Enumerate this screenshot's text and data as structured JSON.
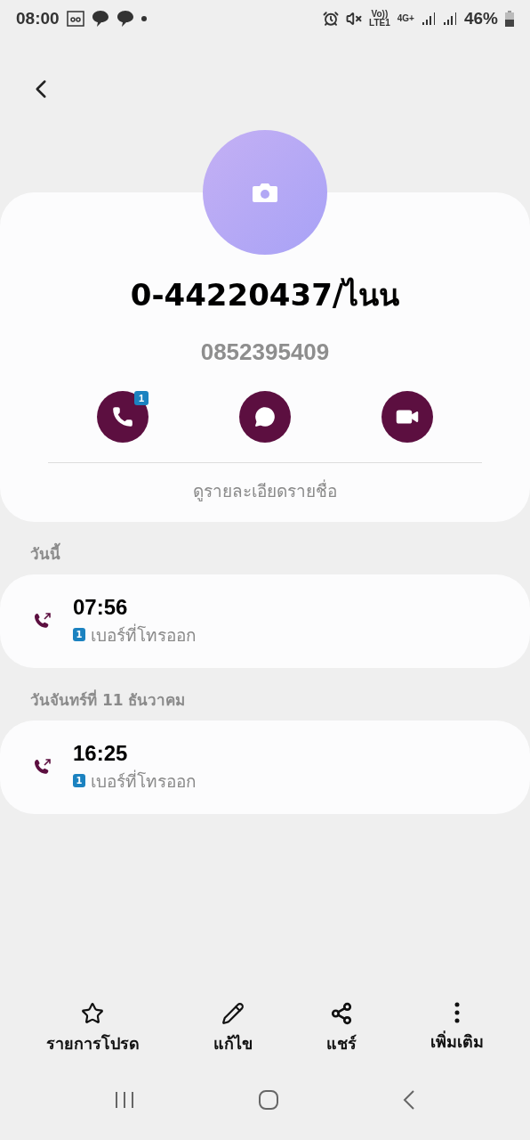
{
  "status_bar": {
    "time": "08:00",
    "volte": "Vo))",
    "lte": "LTE1",
    "network": "4G+",
    "battery": "46%"
  },
  "contact": {
    "name": "0-44220437/ไนน",
    "number": "0852395409",
    "details_link": "ดูรายละเอียดรายชื่อ",
    "actions": [
      {
        "kind": "call",
        "badge": "1"
      },
      {
        "kind": "message"
      },
      {
        "kind": "video"
      }
    ]
  },
  "call_groups": [
    {
      "header": "วันนี้",
      "calls": [
        {
          "time": "07:56",
          "sim": "1",
          "label": "เบอร์ที่โทรออก"
        }
      ]
    },
    {
      "header": "วันจันทร์ที่ 11 ธันวาคม",
      "calls": [
        {
          "time": "16:25",
          "sim": "1",
          "label": "เบอร์ที่โทรออก"
        }
      ]
    }
  ],
  "bottom_bar": [
    {
      "kind": "favorite",
      "label": "รายการโปรด"
    },
    {
      "kind": "edit",
      "label": "แก้ไข"
    },
    {
      "kind": "share",
      "label": "แชร์"
    },
    {
      "kind": "more",
      "label": "เพิ่มเติม"
    }
  ]
}
